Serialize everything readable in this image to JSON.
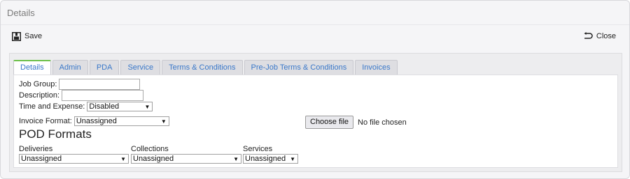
{
  "window": {
    "title": "Details"
  },
  "toolbar": {
    "save_label": "Save",
    "close_label": "Close",
    "save_icon": "save-icon",
    "close_icon": "undo-arrow-icon"
  },
  "tabs": [
    {
      "label": "Details",
      "active": true
    },
    {
      "label": "Admin"
    },
    {
      "label": "PDA"
    },
    {
      "label": "Service"
    },
    {
      "label": "Terms & Conditions"
    },
    {
      "label": "Pre-Job Terms & Conditions"
    },
    {
      "label": "Invoices"
    }
  ],
  "form": {
    "job_group_label": "Job Group:",
    "job_group_value": "",
    "description_label": "Description:",
    "description_value": "",
    "time_expense_label": "Time and Expense:",
    "time_expense_value": "Disabled",
    "invoice_format_label": "Invoice Format:",
    "invoice_format_value": "Unassigned",
    "file_button_label": "Choose file",
    "file_status": "No file chosen"
  },
  "pod": {
    "title": "POD Formats",
    "deliveries_label": "Deliveries",
    "deliveries_value": "Unassigned",
    "collections_label": "Collections",
    "collections_value": "Unassigned",
    "services_label": "Services",
    "services_value": "Unassigned"
  },
  "colors": {
    "tab_text": "#3a78c9",
    "active_tab_accent": "#6cc04a"
  }
}
